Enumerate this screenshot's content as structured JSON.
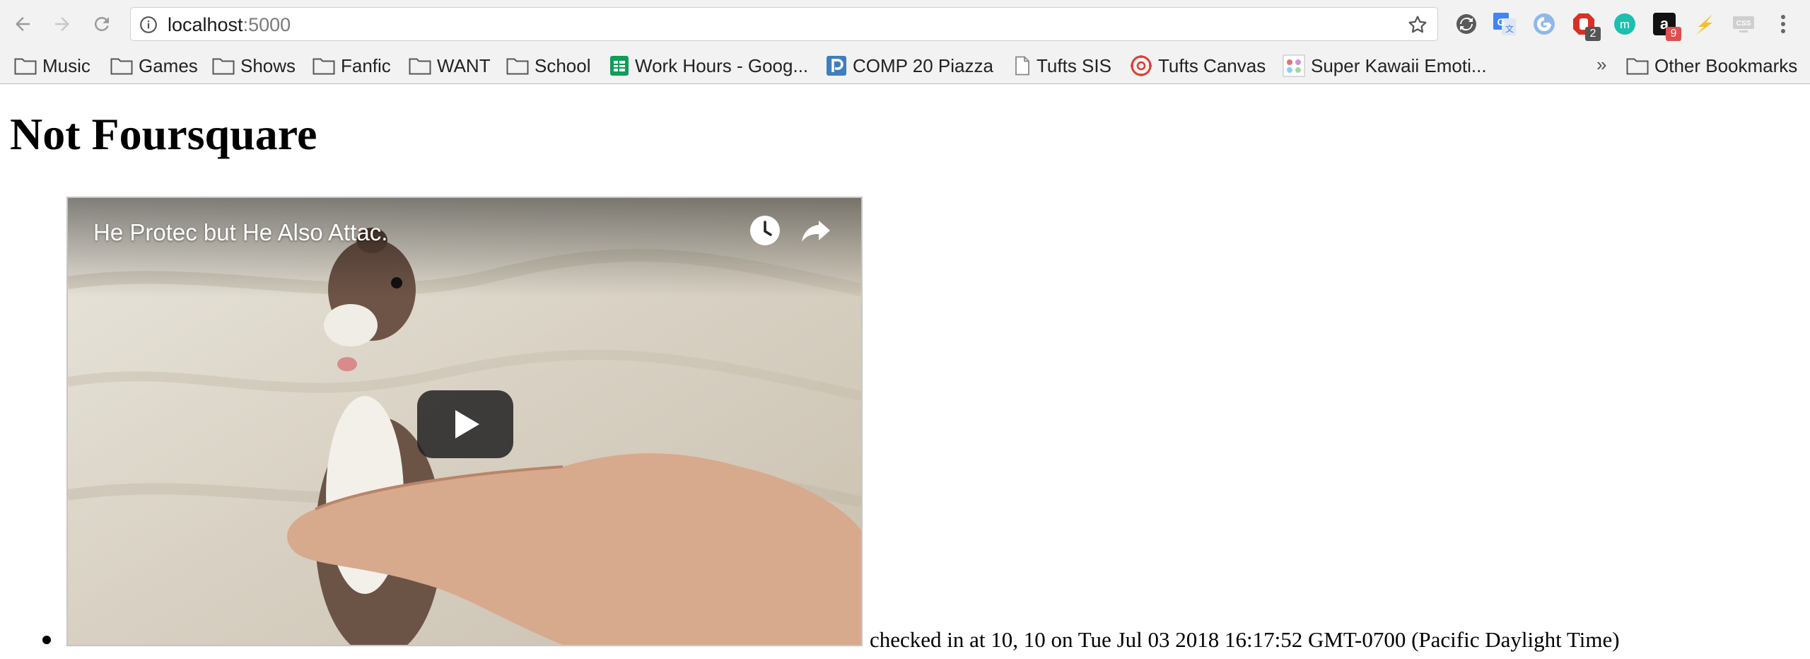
{
  "browser": {
    "url_host": "localhost",
    "url_port": ":5000",
    "extensions": [
      {
        "icon": "sync-icon"
      },
      {
        "icon": "google-translate-icon"
      },
      {
        "icon": "grammarly-icon"
      },
      {
        "icon": "adblock-icon",
        "badge": "2"
      },
      {
        "icon": "mint-icon"
      },
      {
        "icon": "amazon-icon",
        "badge": "9"
      },
      {
        "icon": "lightning-icon"
      },
      {
        "icon": "css-icon"
      }
    ],
    "bookmarks": [
      {
        "label": "Music",
        "icon": "folder-icon"
      },
      {
        "label": "Games",
        "icon": "folder-icon"
      },
      {
        "label": "Shows",
        "icon": "folder-icon"
      },
      {
        "label": "Fanfic",
        "icon": "folder-icon"
      },
      {
        "label": "WANT",
        "icon": "folder-icon"
      },
      {
        "label": "School",
        "icon": "folder-icon"
      },
      {
        "label": "Work Hours - Goog...",
        "icon": "sheets-icon"
      },
      {
        "label": "COMP 20 Piazza",
        "icon": "piazza-icon"
      },
      {
        "label": "Tufts SIS",
        "icon": "page-icon"
      },
      {
        "label": "Tufts Canvas",
        "icon": "canvas-icon"
      },
      {
        "label": "Super Kawaii Emoti...",
        "icon": "kawaii-icon"
      }
    ],
    "overflow_chevron": "»",
    "other_bookmarks": "Other Bookmarks"
  },
  "page": {
    "title": "Not Foursquare",
    "checkins": [
      {
        "video_title": "He Protec but He Also Attac.",
        "text": "checked in at 10, 10 on Tue Jul 03 2018 16:17:52 GMT-0700 (Pacific Daylight Time)"
      }
    ]
  },
  "colors": {
    "chrome_bg": "#f2f2f2",
    "sheets_green": "#0f9d58",
    "piazza_blue": "#3e7ebf",
    "canvas_red": "#e03c31",
    "play_button": "#212121"
  }
}
